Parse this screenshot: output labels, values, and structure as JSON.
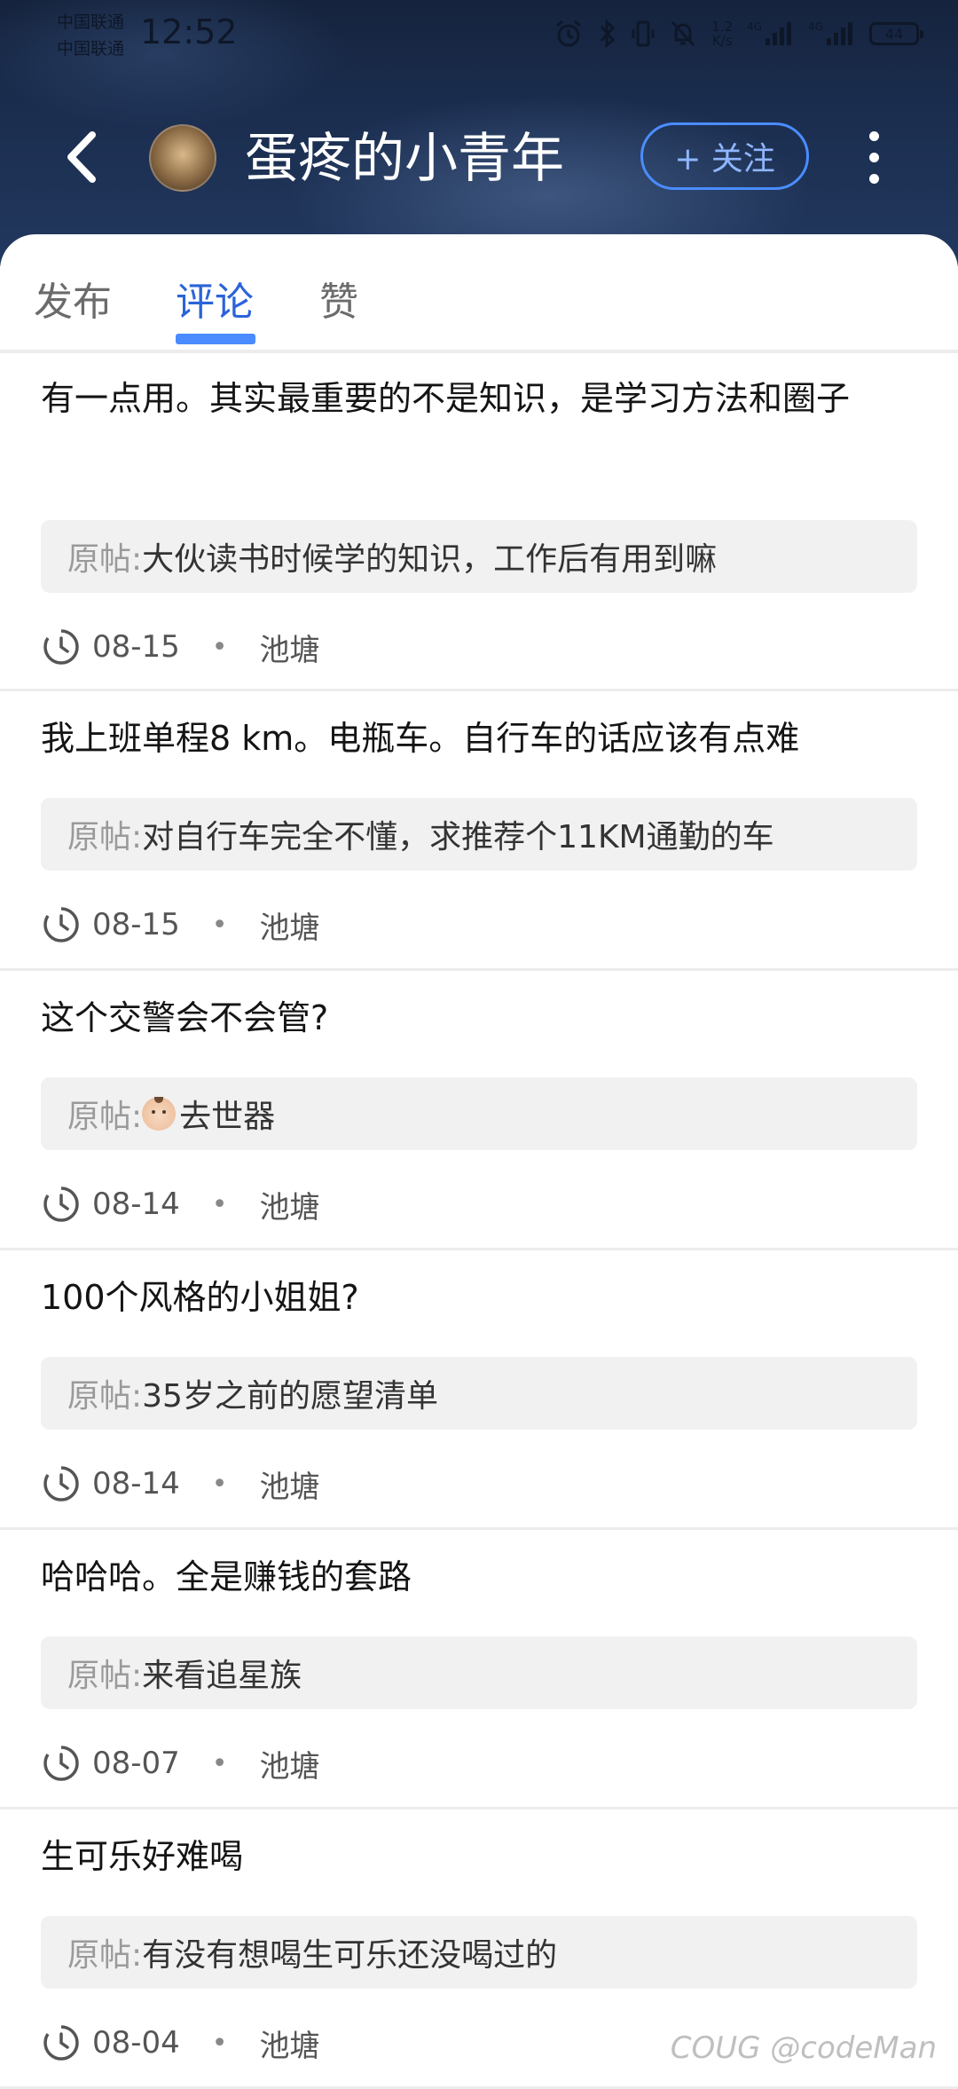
{
  "status_bar": {
    "carrier_1": "中国联通",
    "carrier_2": "中国联通",
    "time": "12:52",
    "net_speed_value": "1.2",
    "net_speed_unit": "K/s",
    "sig_1": "4G",
    "sig_2": "4G",
    "battery": "44"
  },
  "header": {
    "nickname": "蛋疼的小青年",
    "follow_label": "+ 关注"
  },
  "tabs": [
    {
      "label": "发布"
    },
    {
      "label": "评论"
    },
    {
      "label": "赞"
    }
  ],
  "active_tab": "评论",
  "original_prefix": "原帖:",
  "comments": [
    {
      "text": "有一点用。其实最重要的不是知识，是学习方法和圈子",
      "original": "大伙读书时候学的知识，工作后有用到嘛",
      "date": "08-15",
      "circle": "池塘"
    },
    {
      "text": "我上班单程8 km。电瓶车。自行车的话应该有点难",
      "original": "对自行车完全不懂，求推荐个11KM通勤的车",
      "date": "08-15",
      "circle": "池塘"
    },
    {
      "text": "这个交警会不会管?",
      "original": "去世器",
      "date": "08-14",
      "circle": "池塘"
    },
    {
      "text": "100个风格的小姐姐?",
      "original": "35岁之前的愿望清单",
      "date": "08-14",
      "circle": "池塘"
    },
    {
      "text": "哈哈哈。全是赚钱的套路",
      "original": "来看追星族",
      "date": "08-07",
      "circle": "池塘"
    },
    {
      "text": "生可乐好难喝",
      "original": "有没有想喝生可乐还没喝过的",
      "date": "08-04",
      "circle": "池塘"
    }
  ],
  "meta_separator": "•",
  "watermark": "COUG @codeMan",
  "colors": {
    "accent": "#4a8bff",
    "header_bg": "#1b2e50"
  }
}
